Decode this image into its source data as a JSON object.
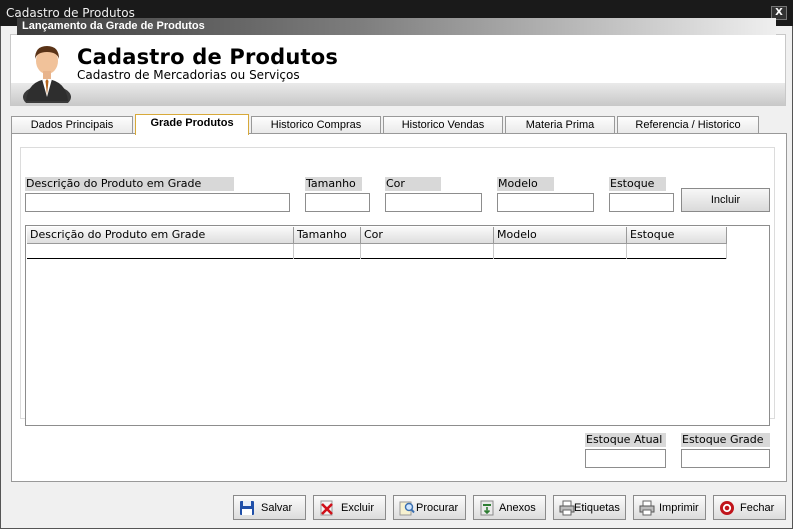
{
  "window": {
    "title": "Cadastro de Produtos",
    "close_label": "X"
  },
  "header": {
    "title": "Cadastro de Produtos",
    "subtitle": "Cadastro de Mercadorias ou Serviços"
  },
  "tabs": [
    {
      "label": "Dados Principais",
      "active": false
    },
    {
      "label": "Grade Produtos",
      "active": true
    },
    {
      "label": "Historico Compras",
      "active": false
    },
    {
      "label": "Historico Vendas",
      "active": false
    },
    {
      "label": "Materia Prima",
      "active": false
    },
    {
      "label": "Referencia / Historico",
      "active": false
    }
  ],
  "grade": {
    "section_title": "Lançamento da Grade de Produtos",
    "fields": {
      "descricao": {
        "label": "Descrição do Produto em Grade",
        "value": ""
      },
      "tamanho": {
        "label": "Tamanho",
        "value": ""
      },
      "cor": {
        "label": "Cor",
        "value": ""
      },
      "modelo": {
        "label": "Modelo",
        "value": ""
      },
      "estoque": {
        "label": "Estoque",
        "value": ""
      }
    },
    "incluir_label": "Incluir",
    "table": {
      "columns": [
        "Descrição do Produto em Grade",
        "Tamanho",
        "Cor",
        "Modelo",
        "Estoque"
      ],
      "rows": []
    },
    "estoque_atual": {
      "label": "Estoque Atual",
      "value": ""
    },
    "estoque_grade": {
      "label": "Estoque Grade",
      "value": ""
    }
  },
  "toolbar": {
    "salvar": "Salvar",
    "excluir": "Excluir",
    "procurar": "Procurar",
    "anexos": "Anexos",
    "etiquetas": "Etiquetas",
    "imprimir": "Imprimir",
    "fechar": "Fechar"
  },
  "icons": {
    "salvar": "floppy-disk-icon",
    "excluir": "delete-x-icon",
    "procurar": "search-icon",
    "anexos": "attachment-icon",
    "etiquetas": "printer-icon",
    "imprimir": "printer-icon",
    "fechar": "close-circle-icon"
  },
  "colors": {
    "active_tab_border": "#d7a93a",
    "close_button_red": "#c0141b"
  }
}
